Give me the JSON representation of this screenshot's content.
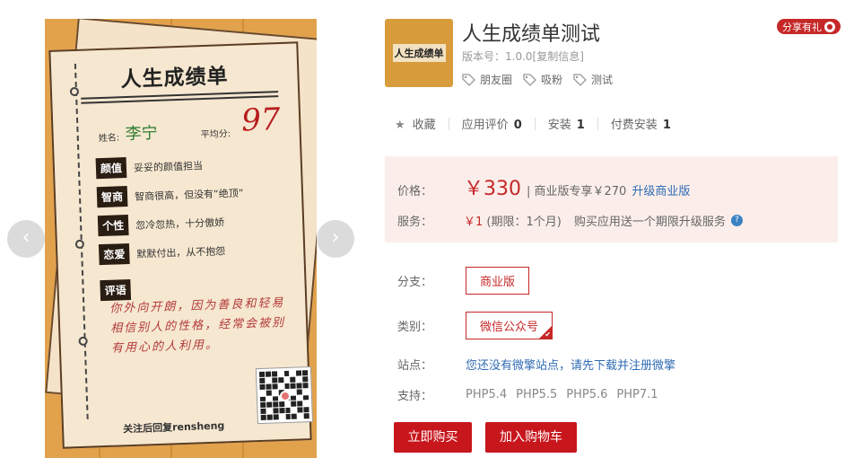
{
  "gallery": {
    "poster": {
      "title": "人生成绩单",
      "name_label": "姓名:",
      "name_value": "李宁",
      "avg_label": "平均分:",
      "avg_value": "97",
      "rows": [
        {
          "tag": "颜值",
          "text": "妥妥的颜值担当"
        },
        {
          "tag": "智商",
          "text": "智商很高，但没有“绝顶”"
        },
        {
          "tag": "个性",
          "text": "忽冷忽热，十分傲娇"
        },
        {
          "tag": "恋爱",
          "text": "默默付出，从不抱怨"
        }
      ],
      "comment_tag": "评语",
      "comment_text": "你外向开朗，因为善良和轻易相信别人的性格，经常会被别有用心的人利用。",
      "follow_text": "关注后回复rensheng"
    },
    "prev_icon": "‹",
    "next_icon": "›"
  },
  "app": {
    "logo_text": "人生成绩单",
    "title": "人生成绩单测试",
    "version": "版本号：1.0.0[复制信息]",
    "tags": [
      "朋友圈",
      "吸粉",
      "测试"
    ],
    "share_label": "分享有礼"
  },
  "stats": {
    "favorite_label": "收藏",
    "review_label": "应用评价",
    "review_count": "0",
    "install_label": "安装",
    "install_count": "1",
    "paid_label": "付费安装",
    "paid_count": "1"
  },
  "pricing": {
    "price_label": "价格：",
    "price": "￥330",
    "pro_text": "| 商业版专享￥270",
    "upgrade_link": "升级商业版",
    "service_label": "服务：",
    "service_value": "￥1",
    "service_note": "(期限：1个月)",
    "service_desc": "购买应用送一个期限升级服务",
    "help_icon": "?"
  },
  "options": {
    "branch_label": "分支：",
    "branch_value": "商业版",
    "category_label": "类别：",
    "category_value": "微信公众号",
    "site_label": "站点：",
    "site_text": "您还没有微擎站点，请先下载并注册微擎",
    "support_label": "支持：",
    "support_versions": [
      "PHP5.4",
      "PHP5.5",
      "PHP5.6",
      "PHP7.1"
    ]
  },
  "actions": {
    "buy_label": "立即购买",
    "cart_label": "加入购物车"
  },
  "colors": {
    "accent": "#c8161d",
    "link": "#2f6bb3",
    "price_bg": "#fbeeea"
  }
}
